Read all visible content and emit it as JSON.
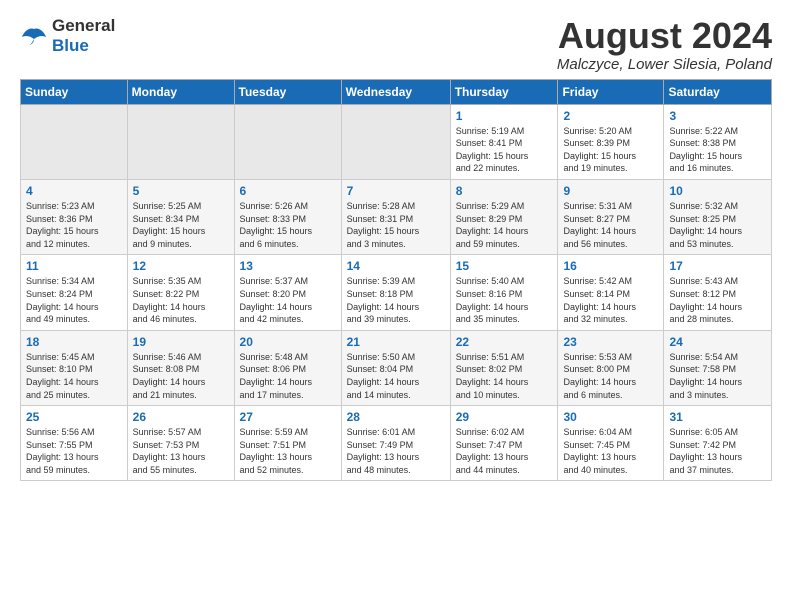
{
  "logo": {
    "general": "General",
    "blue": "Blue"
  },
  "title": {
    "month": "August 2024",
    "location": "Malczyce, Lower Silesia, Poland"
  },
  "weekdays": [
    "Sunday",
    "Monday",
    "Tuesday",
    "Wednesday",
    "Thursday",
    "Friday",
    "Saturday"
  ],
  "weeks": [
    [
      {
        "day": "",
        "detail": ""
      },
      {
        "day": "",
        "detail": ""
      },
      {
        "day": "",
        "detail": ""
      },
      {
        "day": "",
        "detail": ""
      },
      {
        "day": "1",
        "detail": "Sunrise: 5:19 AM\nSunset: 8:41 PM\nDaylight: 15 hours\nand 22 minutes."
      },
      {
        "day": "2",
        "detail": "Sunrise: 5:20 AM\nSunset: 8:39 PM\nDaylight: 15 hours\nand 19 minutes."
      },
      {
        "day": "3",
        "detail": "Sunrise: 5:22 AM\nSunset: 8:38 PM\nDaylight: 15 hours\nand 16 minutes."
      }
    ],
    [
      {
        "day": "4",
        "detail": "Sunrise: 5:23 AM\nSunset: 8:36 PM\nDaylight: 15 hours\nand 12 minutes."
      },
      {
        "day": "5",
        "detail": "Sunrise: 5:25 AM\nSunset: 8:34 PM\nDaylight: 15 hours\nand 9 minutes."
      },
      {
        "day": "6",
        "detail": "Sunrise: 5:26 AM\nSunset: 8:33 PM\nDaylight: 15 hours\nand 6 minutes."
      },
      {
        "day": "7",
        "detail": "Sunrise: 5:28 AM\nSunset: 8:31 PM\nDaylight: 15 hours\nand 3 minutes."
      },
      {
        "day": "8",
        "detail": "Sunrise: 5:29 AM\nSunset: 8:29 PM\nDaylight: 14 hours\nand 59 minutes."
      },
      {
        "day": "9",
        "detail": "Sunrise: 5:31 AM\nSunset: 8:27 PM\nDaylight: 14 hours\nand 56 minutes."
      },
      {
        "day": "10",
        "detail": "Sunrise: 5:32 AM\nSunset: 8:25 PM\nDaylight: 14 hours\nand 53 minutes."
      }
    ],
    [
      {
        "day": "11",
        "detail": "Sunrise: 5:34 AM\nSunset: 8:24 PM\nDaylight: 14 hours\nand 49 minutes."
      },
      {
        "day": "12",
        "detail": "Sunrise: 5:35 AM\nSunset: 8:22 PM\nDaylight: 14 hours\nand 46 minutes."
      },
      {
        "day": "13",
        "detail": "Sunrise: 5:37 AM\nSunset: 8:20 PM\nDaylight: 14 hours\nand 42 minutes."
      },
      {
        "day": "14",
        "detail": "Sunrise: 5:39 AM\nSunset: 8:18 PM\nDaylight: 14 hours\nand 39 minutes."
      },
      {
        "day": "15",
        "detail": "Sunrise: 5:40 AM\nSunset: 8:16 PM\nDaylight: 14 hours\nand 35 minutes."
      },
      {
        "day": "16",
        "detail": "Sunrise: 5:42 AM\nSunset: 8:14 PM\nDaylight: 14 hours\nand 32 minutes."
      },
      {
        "day": "17",
        "detail": "Sunrise: 5:43 AM\nSunset: 8:12 PM\nDaylight: 14 hours\nand 28 minutes."
      }
    ],
    [
      {
        "day": "18",
        "detail": "Sunrise: 5:45 AM\nSunset: 8:10 PM\nDaylight: 14 hours\nand 25 minutes."
      },
      {
        "day": "19",
        "detail": "Sunrise: 5:46 AM\nSunset: 8:08 PM\nDaylight: 14 hours\nand 21 minutes."
      },
      {
        "day": "20",
        "detail": "Sunrise: 5:48 AM\nSunset: 8:06 PM\nDaylight: 14 hours\nand 17 minutes."
      },
      {
        "day": "21",
        "detail": "Sunrise: 5:50 AM\nSunset: 8:04 PM\nDaylight: 14 hours\nand 14 minutes."
      },
      {
        "day": "22",
        "detail": "Sunrise: 5:51 AM\nSunset: 8:02 PM\nDaylight: 14 hours\nand 10 minutes."
      },
      {
        "day": "23",
        "detail": "Sunrise: 5:53 AM\nSunset: 8:00 PM\nDaylight: 14 hours\nand 6 minutes."
      },
      {
        "day": "24",
        "detail": "Sunrise: 5:54 AM\nSunset: 7:58 PM\nDaylight: 14 hours\nand 3 minutes."
      }
    ],
    [
      {
        "day": "25",
        "detail": "Sunrise: 5:56 AM\nSunset: 7:55 PM\nDaylight: 13 hours\nand 59 minutes."
      },
      {
        "day": "26",
        "detail": "Sunrise: 5:57 AM\nSunset: 7:53 PM\nDaylight: 13 hours\nand 55 minutes."
      },
      {
        "day": "27",
        "detail": "Sunrise: 5:59 AM\nSunset: 7:51 PM\nDaylight: 13 hours\nand 52 minutes."
      },
      {
        "day": "28",
        "detail": "Sunrise: 6:01 AM\nSunset: 7:49 PM\nDaylight: 13 hours\nand 48 minutes."
      },
      {
        "day": "29",
        "detail": "Sunrise: 6:02 AM\nSunset: 7:47 PM\nDaylight: 13 hours\nand 44 minutes."
      },
      {
        "day": "30",
        "detail": "Sunrise: 6:04 AM\nSunset: 7:45 PM\nDaylight: 13 hours\nand 40 minutes."
      },
      {
        "day": "31",
        "detail": "Sunrise: 6:05 AM\nSunset: 7:42 PM\nDaylight: 13 hours\nand 37 minutes."
      }
    ]
  ]
}
